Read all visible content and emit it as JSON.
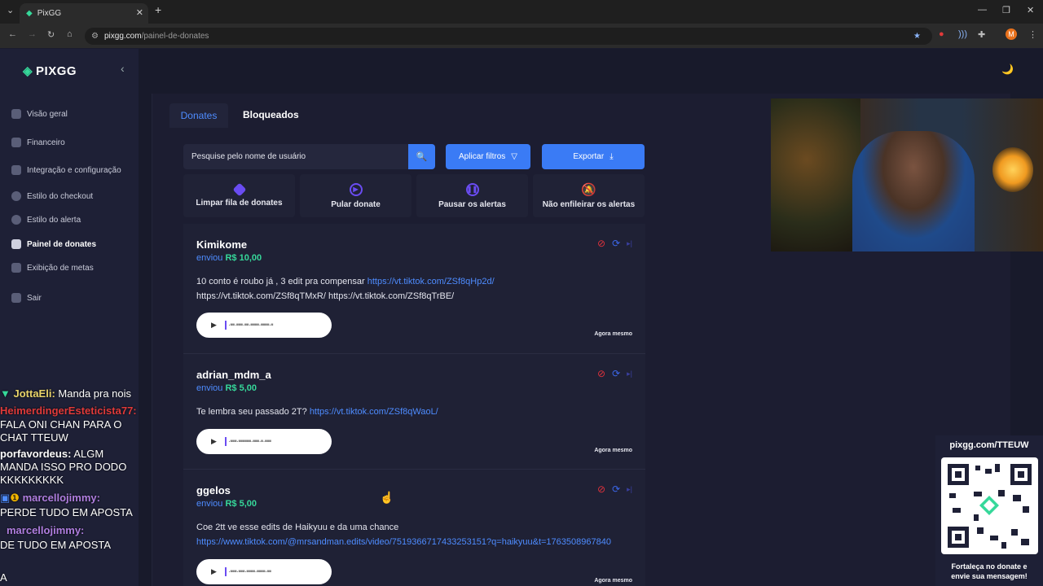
{
  "browser": {
    "tab_title": "PixGG",
    "url_host": "pixgg.com",
    "url_path": "/painel-de-donates"
  },
  "sidebar": {
    "logo": "PIXGG",
    "items": [
      {
        "label": "Visão geral"
      },
      {
        "label": "Financeiro"
      },
      {
        "label": "Integração e configuração"
      },
      {
        "label": "Estilo do checkout"
      },
      {
        "label": "Estilo do alerta"
      },
      {
        "label": "Painel de donates"
      },
      {
        "label": "Exibição de metas"
      },
      {
        "label": "Sair"
      }
    ]
  },
  "tabs": {
    "donates": "Donates",
    "bloqueados": "Bloqueados"
  },
  "filters": {
    "search_placeholder": "Pesquise pelo nome de usuário",
    "apply_label": "Aplicar filtros",
    "export_label": "Exportar"
  },
  "actions": [
    {
      "label": "Limpar fila de donates"
    },
    {
      "label": "Pular donate"
    },
    {
      "label": "Pausar os alertas"
    },
    {
      "label": "Não enfileirar os alertas"
    }
  ],
  "donations": [
    {
      "user": "Kimikome",
      "sent": "enviou",
      "amount": "R$ 10,00",
      "message_text": "10 conto é roubo já , 3 edit pra compensar",
      "message_link": "https://vt.tiktok.com/ZSf8qHp2d/",
      "message_text2": "https://vt.tiktok.com/ZSf8qTMxR/ https://vt.tiktok.com/ZSf8qTrBE/",
      "time": "Agora mesmo"
    },
    {
      "user": "adrian_mdm_a",
      "sent": "enviou",
      "amount": "R$ 5,00",
      "message_text": "Te lembra seu passado 2T?",
      "message_link": "https://vt.tiktok.com/ZSf8qWaoL/",
      "message_text2": "",
      "time": "Agora mesmo"
    },
    {
      "user": "ggelos",
      "sent": "enviou",
      "amount": "R$ 5,00",
      "message_text": "Coe 2tt ve esse edits de Haikyuu e da uma chance",
      "message_link": "https://www.tiktok.com/@mrsandman.edits/video/7519366717433253151?q=haikyuu&t=1763508967840",
      "message_text2": "",
      "time": "Agora mesmo"
    }
  ],
  "chat": [
    {
      "user": "JottaEli:",
      "text": "Manda pra nois",
      "color": "#e9d36a"
    },
    {
      "user": "HeimerdingerEsteticista77:",
      "text": "FALA ONI CHAN PARA O",
      "color": "#e03a3a"
    },
    {
      "user": "",
      "text": "CHAT TTEUW",
      "color": "#ffffff"
    },
    {
      "user": "porfavordeus:",
      "text": "ALGM",
      "color": "#ffffff"
    },
    {
      "user": "",
      "text": "MANDA ISSO PRO DODO",
      "color": "#ffffff"
    },
    {
      "user": "",
      "text": "KKKKKKKKK",
      "color": "#ffffff"
    },
    {
      "user": "marcellojimmy:",
      "text": "",
      "color": "#b07ee0"
    },
    {
      "user": "",
      "text": "PERDE TUDO EM APOSTA",
      "color": "#ffffff"
    },
    {
      "user": "marcellojimmy:",
      "text": "",
      "color": "#b07ee0"
    },
    {
      "user": "",
      "text": "DE TUDO EM APOSTA",
      "color": "#ffffff"
    },
    {
      "user": "",
      "text": "A",
      "color": "#ffffff"
    }
  ],
  "qr": {
    "url": "pixgg.com/TTEUW",
    "caption_1": "Fortaleça no donate e",
    "caption_2": "envie sua mensagem!"
  },
  "colors": {
    "accent_blue": "#3a7bf5",
    "accent_green": "#36d89a",
    "accent_purple": "#6a4cf2",
    "block_red": "#e0323c"
  }
}
